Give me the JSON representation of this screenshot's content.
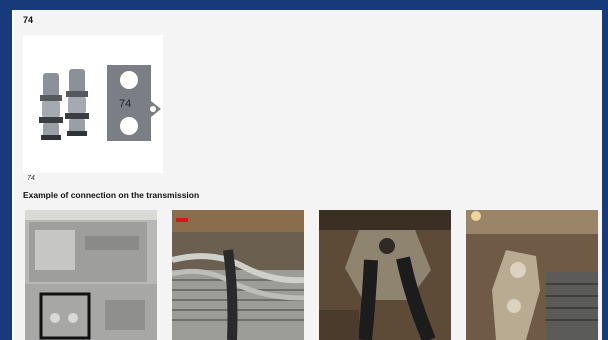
{
  "section": {
    "title": "74"
  },
  "product_image": {
    "caption": "74",
    "plate_label": "74"
  },
  "connection": {
    "heading": "Example of connection on the transmission"
  },
  "photos": [
    {
      "name": "transmission-housing-photo"
    },
    {
      "name": "radiator-hoses-photo"
    },
    {
      "name": "pipe-flange-photo"
    },
    {
      "name": "engine-bay-photo"
    }
  ],
  "colors": {
    "background": "#173a7a",
    "panel": "#f4f4f4"
  }
}
